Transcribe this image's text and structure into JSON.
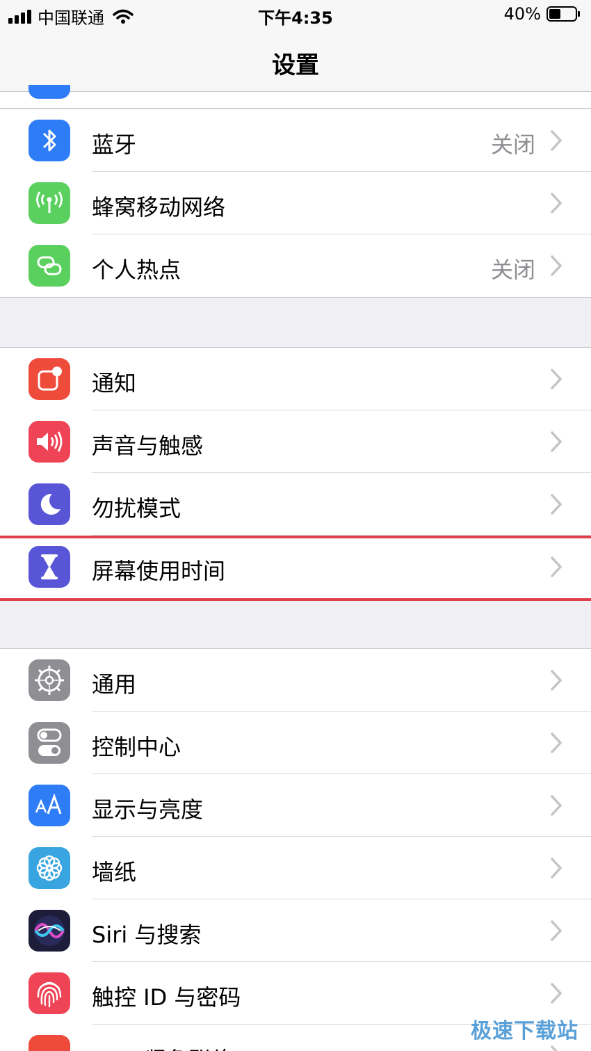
{
  "status_bar": {
    "carrier": "中国联通",
    "time": "下午4:35",
    "battery": "40%"
  },
  "nav": {
    "title": "设置"
  },
  "groups": [
    {
      "items": [
        {
          "label": "蓝牙",
          "value": "关闭",
          "icon": "bluetooth-icon",
          "color": "#2e7cf6"
        },
        {
          "label": "蜂窝移动网络",
          "value": "",
          "icon": "cellular-antenna-icon",
          "color": "#5ad05e"
        },
        {
          "label": "个人热点",
          "value": "关闭",
          "icon": "hotspot-link-icon",
          "color": "#5ad05e"
        }
      ]
    },
    {
      "items": [
        {
          "label": "通知",
          "value": "",
          "icon": "notification-icon",
          "color": "#ee4b3b"
        },
        {
          "label": "声音与触感",
          "value": "",
          "icon": "speaker-icon",
          "color": "#ef4455"
        },
        {
          "label": "勿扰模式",
          "value": "",
          "icon": "moon-icon",
          "color": "#5856d6"
        },
        {
          "label": "屏幕使用时间",
          "value": "",
          "icon": "hourglass-icon",
          "color": "#5856d6"
        }
      ]
    },
    {
      "items": [
        {
          "label": "通用",
          "value": "",
          "icon": "gear-icon",
          "color": "#8e8e93"
        },
        {
          "label": "控制中心",
          "value": "",
          "icon": "toggles-icon",
          "color": "#8e8e93"
        },
        {
          "label": "显示与亮度",
          "value": "",
          "icon": "text-size-icon",
          "color": "#2e7cf6"
        },
        {
          "label": "墙纸",
          "value": "",
          "icon": "flower-icon",
          "color": "#38a4e0"
        },
        {
          "label": "Siri 与搜索",
          "value": "",
          "icon": "siri-icon",
          "color": "#1d1d3a"
        },
        {
          "label": "触控 ID 与密码",
          "value": "",
          "icon": "fingerprint-icon",
          "color": "#ef4455"
        },
        {
          "label": "SOS 紧急联络",
          "value": "",
          "icon": "sos-icon",
          "color": "#ee4b3b"
        }
      ]
    }
  ],
  "watermark": "极速下载站"
}
